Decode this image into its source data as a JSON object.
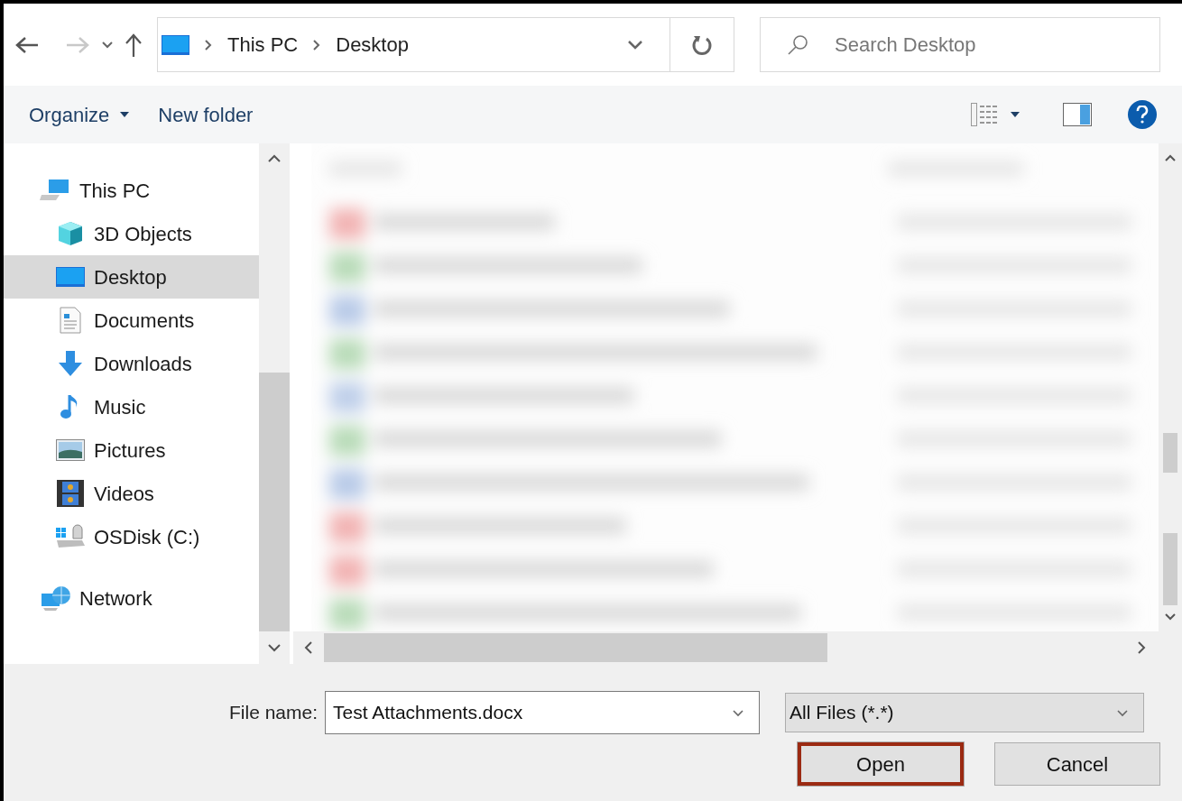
{
  "address_bar": {
    "breadcrumbs": [
      "This PC",
      "Desktop"
    ]
  },
  "search": {
    "placeholder": "Search Desktop"
  },
  "toolbar": {
    "buttons": [
      "Organize",
      "New folder"
    ]
  },
  "sidebar": {
    "items": [
      {
        "label": "This PC",
        "kind": "pc",
        "selected": false,
        "children": [
          {
            "label": "3D Objects",
            "kind": "cube",
            "selected": false
          },
          {
            "label": "Desktop",
            "kind": "desktop",
            "selected": true
          },
          {
            "label": "Documents",
            "kind": "document",
            "selected": false
          },
          {
            "label": "Downloads",
            "kind": "download",
            "selected": false
          },
          {
            "label": "Music",
            "kind": "music",
            "selected": false
          },
          {
            "label": "Pictures",
            "kind": "pictures",
            "selected": false
          },
          {
            "label": "Videos",
            "kind": "videos",
            "selected": false
          },
          {
            "label": "OSDisk (C:)",
            "kind": "disk",
            "selected": false
          }
        ]
      },
      {
        "label": "Network",
        "kind": "network",
        "selected": false
      }
    ]
  },
  "footer": {
    "file_name_label": "File name:",
    "file_name": "Test Attachments.docx",
    "file_type": "All Files (*.*)",
    "buttons": [
      {
        "label": "Open",
        "highlighted": true
      },
      {
        "label": "Cancel",
        "highlighted": false
      }
    ]
  }
}
